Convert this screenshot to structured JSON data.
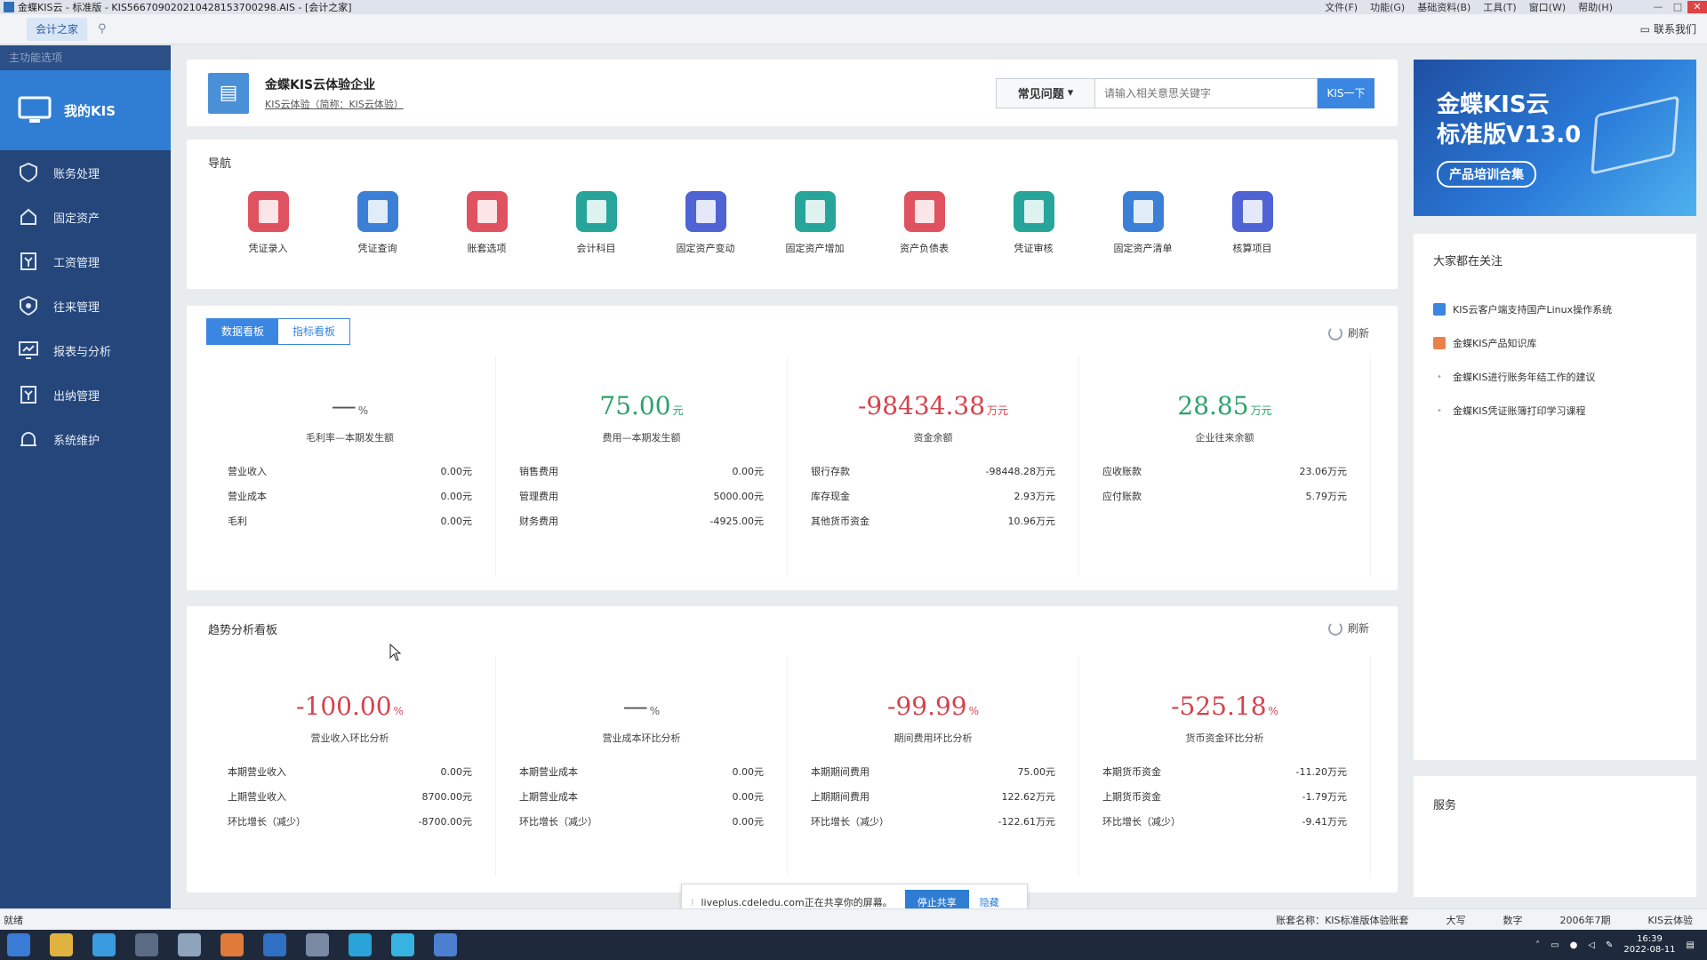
{
  "window": {
    "title": "金蝶KIS云 - 标准版 - KIS566709020210428153700298.AIS - [会计之家]",
    "menus": [
      "文件(F)",
      "功能(G)",
      "基础资料(B)",
      "工具(T)",
      "窗口(W)",
      "帮助(H)"
    ],
    "controls": [
      "—",
      "□",
      "✕"
    ]
  },
  "tabstrip": {
    "active_tab": "会计之家",
    "contact_label": "联系我们"
  },
  "sidebar": {
    "header": "主功能选项",
    "main_label": "我的KIS",
    "items": [
      {
        "label": "账务处理",
        "icon": "ledger-icon"
      },
      {
        "label": "固定资产",
        "icon": "assets-icon"
      },
      {
        "label": "工资管理",
        "icon": "payroll-icon"
      },
      {
        "label": "往来管理",
        "icon": "exchange-icon"
      },
      {
        "label": "报表与分析",
        "icon": "report-icon"
      },
      {
        "label": "出纳管理",
        "icon": "cashier-icon"
      },
      {
        "label": "系统维护",
        "icon": "maintenance-icon"
      }
    ]
  },
  "company": {
    "name": "金蝶KIS云体验企业",
    "subtitle": "KIS云体验（简称：KIS云体验）",
    "faq_label": "常见问题",
    "search_placeholder": "请输入相关意思关键字",
    "search_button": "KIS一下"
  },
  "nav": {
    "title": "导航",
    "items": [
      {
        "label": "凭证录入",
        "color": "#e0525f"
      },
      {
        "label": "凭证查询",
        "color": "#3b7fd6"
      },
      {
        "label": "账套选项",
        "color": "#e0525f"
      },
      {
        "label": "会计科目",
        "color": "#27a59a"
      },
      {
        "label": "固定资产变动",
        "color": "#4f63d4"
      },
      {
        "label": "固定资产增加",
        "color": "#27a59a"
      },
      {
        "label": "资产负债表",
        "color": "#e0525f"
      },
      {
        "label": "凭证审核",
        "color": "#27a59a"
      },
      {
        "label": "固定资产清单",
        "color": "#3b7fd6"
      },
      {
        "label": "核算项目",
        "color": "#4f63d4"
      }
    ]
  },
  "data_board": {
    "tab_active": "数据看板",
    "tab_other": "指标看板",
    "refresh": "刷新",
    "kpis": [
      {
        "value": "—",
        "unit": "%",
        "label": "毛利率—本期发生额",
        "color": "gray",
        "rows": [
          {
            "name": "营业收入",
            "value": "0.00元"
          },
          {
            "name": "营业成本",
            "value": "0.00元"
          },
          {
            "name": "毛利",
            "value": "0.00元"
          }
        ]
      },
      {
        "value": "75.00",
        "unit": "元",
        "label": "费用—本期发生额",
        "color": "green",
        "rows": [
          {
            "name": "销售费用",
            "value": "0.00元"
          },
          {
            "name": "管理费用",
            "value": "5000.00元"
          },
          {
            "name": "财务费用",
            "value": "-4925.00元"
          }
        ]
      },
      {
        "value": "-98434.38",
        "unit": "万元",
        "label": "资金余额",
        "color": "red",
        "rows": [
          {
            "name": "银行存款",
            "value": "-98448.28万元"
          },
          {
            "name": "库存现金",
            "value": "2.93万元"
          },
          {
            "name": "其他货币资金",
            "value": "10.96万元"
          }
        ]
      },
      {
        "value": "28.85",
        "unit": "万元",
        "label": "企业往来余额",
        "color": "green",
        "rows": [
          {
            "name": "应收账款",
            "value": "23.06万元"
          },
          {
            "name": "应付账款",
            "value": "5.79万元"
          }
        ]
      }
    ]
  },
  "trend_board": {
    "title": "趋势分析看板",
    "refresh": "刷新",
    "kpis": [
      {
        "value": "-100.00",
        "unit": "%",
        "label": "营业收入环比分析",
        "color": "red",
        "rows": [
          {
            "name": "本期营业收入",
            "value": "0.00元"
          },
          {
            "name": "上期营业收入",
            "value": "8700.00元"
          },
          {
            "name": "环比增长（减少）",
            "value": "-8700.00元"
          }
        ]
      },
      {
        "value": "—",
        "unit": "%",
        "label": "营业成本环比分析",
        "color": "gray",
        "rows": [
          {
            "name": "本期营业成本",
            "value": "0.00元"
          },
          {
            "name": "上期营业成本",
            "value": "0.00元"
          },
          {
            "name": "环比增长（减少）",
            "value": "0.00元"
          }
        ]
      },
      {
        "value": "-99.99",
        "unit": "%",
        "label": "期间费用环比分析",
        "color": "red",
        "rows": [
          {
            "name": "本期期间费用",
            "value": "75.00元"
          },
          {
            "name": "上期期间费用",
            "value": "122.62万元"
          },
          {
            "name": "环比增长（减少）",
            "value": "-122.61万元"
          }
        ]
      },
      {
        "value": "-525.18",
        "unit": "%",
        "label": "货币资金环比分析",
        "color": "red",
        "rows": [
          {
            "name": "本期货币资金",
            "value": "-11.20万元"
          },
          {
            "name": "上期货币资金",
            "value": "-1.79万元"
          },
          {
            "name": "环比增长（减少）",
            "value": "-9.41万元"
          }
        ]
      }
    ]
  },
  "right": {
    "banner_line1": "金蝶KIS云",
    "banner_line2": "标准版V13.0",
    "banner_pill": "产品培训合集",
    "focus_title": "大家都在关注",
    "focus_items": [
      {
        "label": "KIS云客户端支持国产Linux操作系统",
        "icon": "blue"
      },
      {
        "label": "金蝶KIS产品知识库",
        "icon": "orange"
      },
      {
        "label": "金蝶KIS进行账务年结工作的建议",
        "icon": "dot"
      },
      {
        "label": "金蝶KIS凭证账簿打印学习课程",
        "icon": "dot"
      }
    ],
    "service_title": "服务"
  },
  "sharebar": {
    "text": "liveplus.cdeledu.com正在共享你的屏幕。",
    "stop": "停止共享",
    "hide": "隐藏"
  },
  "statusbar": {
    "left": "就绪",
    "items": [
      "账套名称：KIS标准版体验账套",
      "大写",
      "数字",
      "2006年7期",
      "KIS云体验"
    ]
  },
  "taskbar": {
    "time": "16:39",
    "date": "2022-08-11"
  },
  "colors": {
    "sidebar": "#24467b",
    "sidebar_active": "#2f7ed3",
    "accent": "#3b86e0",
    "positive": "#2ba36a",
    "negative": "#d6424d"
  }
}
